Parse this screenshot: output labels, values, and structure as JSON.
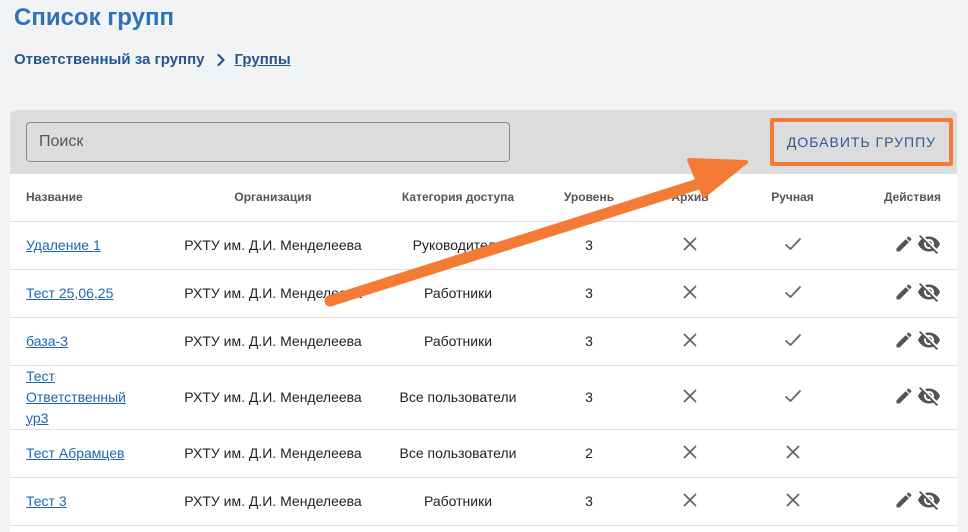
{
  "page": {
    "title": "Список групп"
  },
  "breadcrumb": {
    "parent": "Ответственный за группу",
    "current": "Группы"
  },
  "toolbar": {
    "search_placeholder": "Поиск",
    "search_value": "",
    "add_button_label": "ДОБАВИТЬ ГРУППУ"
  },
  "table": {
    "headers": {
      "name": "Название",
      "organization": "Организация",
      "category": "Категория доступа",
      "level": "Уровень",
      "archive": "Архив",
      "manual": "Ручная",
      "actions": "Действия"
    },
    "rows": [
      {
        "name": "Удаление 1",
        "organization": "РХТУ им. Д.И. Менделеева",
        "category": "Руководители",
        "level": "3",
        "archive": "cross",
        "manual": "check",
        "actions": [
          "edit-icon",
          "visibility-off-icon"
        ]
      },
      {
        "name": "Тест 25,06,25",
        "organization": "РХТУ им. Д.И. Менделеева",
        "category": "Работники",
        "level": "3",
        "archive": "cross",
        "manual": "check",
        "actions": [
          "edit-icon",
          "visibility-off-icon"
        ]
      },
      {
        "name": "база-3",
        "organization": "РХТУ им. Д.И. Менделеева",
        "category": "Работники",
        "level": "3",
        "archive": "cross",
        "manual": "check",
        "actions": [
          "edit-icon",
          "visibility-off-icon"
        ]
      },
      {
        "name": "Тест Ответственный ур3",
        "organization": "РХТУ им. Д.И. Менделеева",
        "category": "Все пользователи",
        "level": "3",
        "archive": "cross",
        "manual": "check",
        "actions": [
          "edit-icon",
          "visibility-off-icon"
        ]
      },
      {
        "name": "Тест Абрамцев",
        "organization": "РХТУ им. Д.И. Менделеева",
        "category": "Все пользователи",
        "level": "2",
        "archive": "cross",
        "manual": "cross",
        "actions": []
      },
      {
        "name": "Тест 3",
        "organization": "РХТУ им. Д.И. Менделеева",
        "category": "Работники",
        "level": "3",
        "archive": "cross",
        "manual": "cross",
        "actions": [
          "edit-icon",
          "visibility-off-icon"
        ]
      }
    ]
  },
  "colors": {
    "title": "#2e73b8",
    "link": "#1f66b0",
    "highlight": "#f47b35",
    "toolbar_bg": "#dcdcdc",
    "page_bg": "#f2f3f5"
  }
}
